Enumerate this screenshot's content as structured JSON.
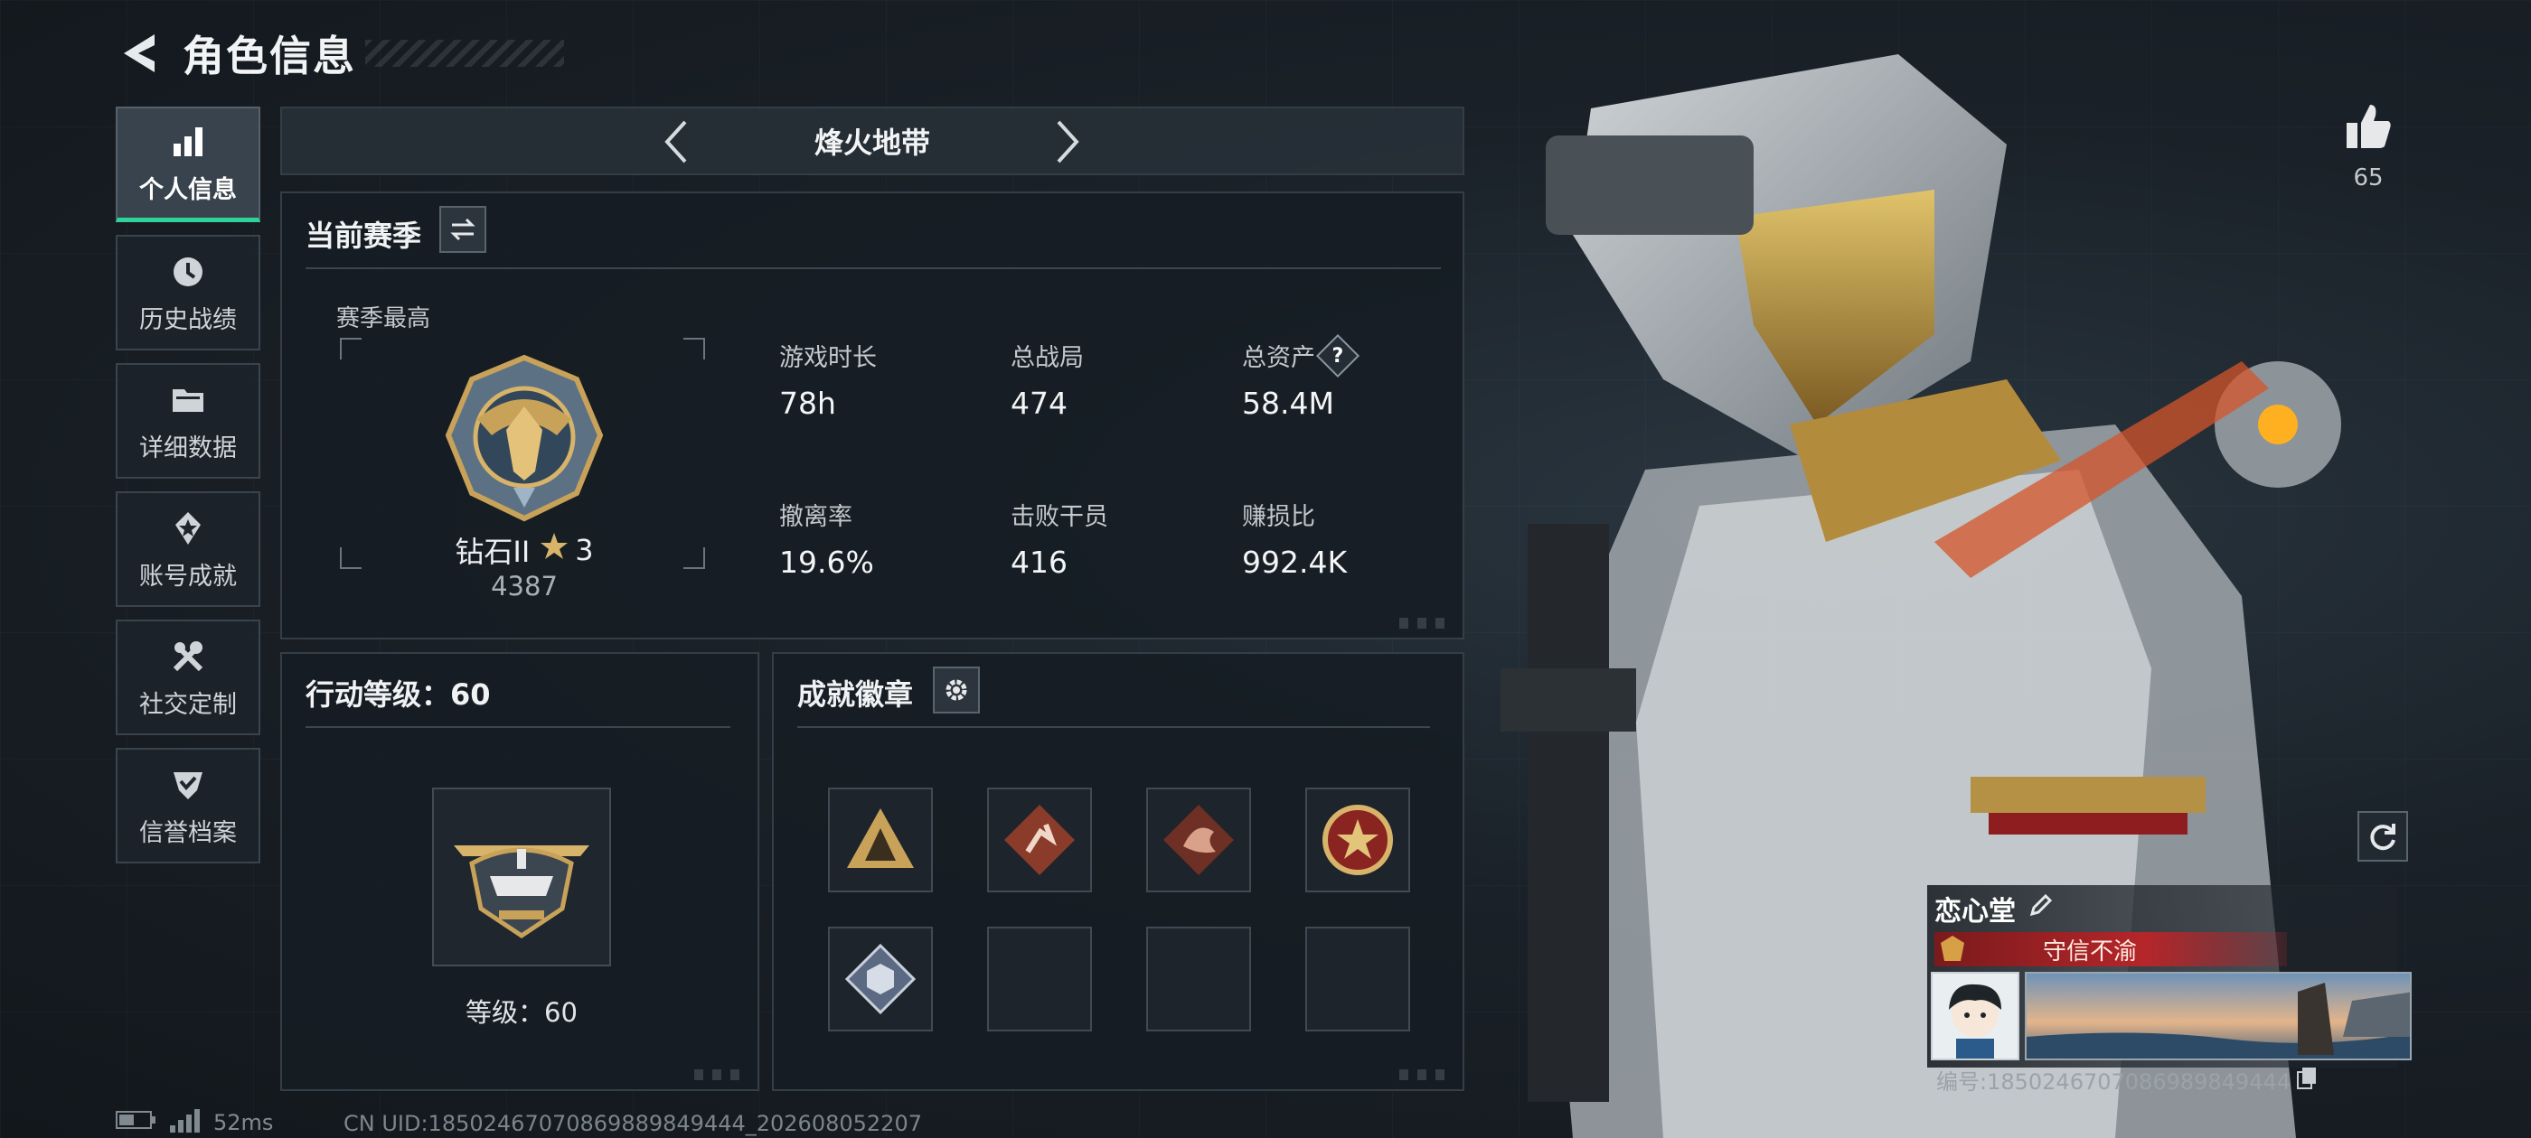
{
  "header": {
    "title": "角色信息",
    "back_icon": "back-arrow-icon"
  },
  "sidebar": {
    "items": [
      {
        "label": "个人信息",
        "icon": "bar-chart-icon",
        "active": true
      },
      {
        "label": "历史战绩",
        "icon": "clock-history-icon",
        "active": false
      },
      {
        "label": "详细数据",
        "icon": "folder-icon",
        "active": false
      },
      {
        "label": "账号成就",
        "icon": "achievement-star-icon",
        "active": false
      },
      {
        "label": "社交定制",
        "icon": "wrench-tools-icon",
        "active": false
      },
      {
        "label": "信誉档案",
        "icon": "shield-check-icon",
        "active": false
      }
    ]
  },
  "mode": {
    "name": "烽火地带"
  },
  "season": {
    "title": "当前赛季",
    "best_label": "赛季最高",
    "rank_name": "钻石II",
    "rank_stars": "3",
    "rank_score": "4387",
    "stats": [
      {
        "label": "游戏时长",
        "value": "78h"
      },
      {
        "label": "总战局",
        "value": "474"
      },
      {
        "label": "总资产",
        "value": "58.4M",
        "has_help": true
      },
      {
        "label": "撤离率",
        "value": "19.6%"
      },
      {
        "label": "击败干员",
        "value": "416"
      },
      {
        "label": "赚损比",
        "value": "992.4K"
      }
    ],
    "help_mark": "?"
  },
  "level": {
    "title": "行动等级：60",
    "caption": "等级：60"
  },
  "badges": {
    "title": "成就徽章",
    "slots": [
      {
        "icon": "tri-soldiers-badge-icon",
        "filled": true
      },
      {
        "icon": "runner-badge-icon",
        "filled": true
      },
      {
        "icon": "dragon-badge-icon",
        "filled": true
      },
      {
        "icon": "star-seal-badge-icon",
        "filled": true
      },
      {
        "icon": "cube-badge-icon",
        "filled": true
      },
      {
        "icon": "",
        "filled": false
      },
      {
        "icon": "",
        "filled": false
      },
      {
        "icon": "",
        "filled": false
      }
    ]
  },
  "likes": {
    "count": "65"
  },
  "profile": {
    "nickname": "恋心堂",
    "title_text": "守信不渝",
    "player_id": "编号:1850246707086989849444"
  },
  "status": {
    "ping": "52ms",
    "uid": "CN UID:18502467070869889849444_202608052207"
  },
  "colors": {
    "accent_green": "#2fd39a",
    "gold": "#c9a25a",
    "title_red": "#b5262a"
  }
}
